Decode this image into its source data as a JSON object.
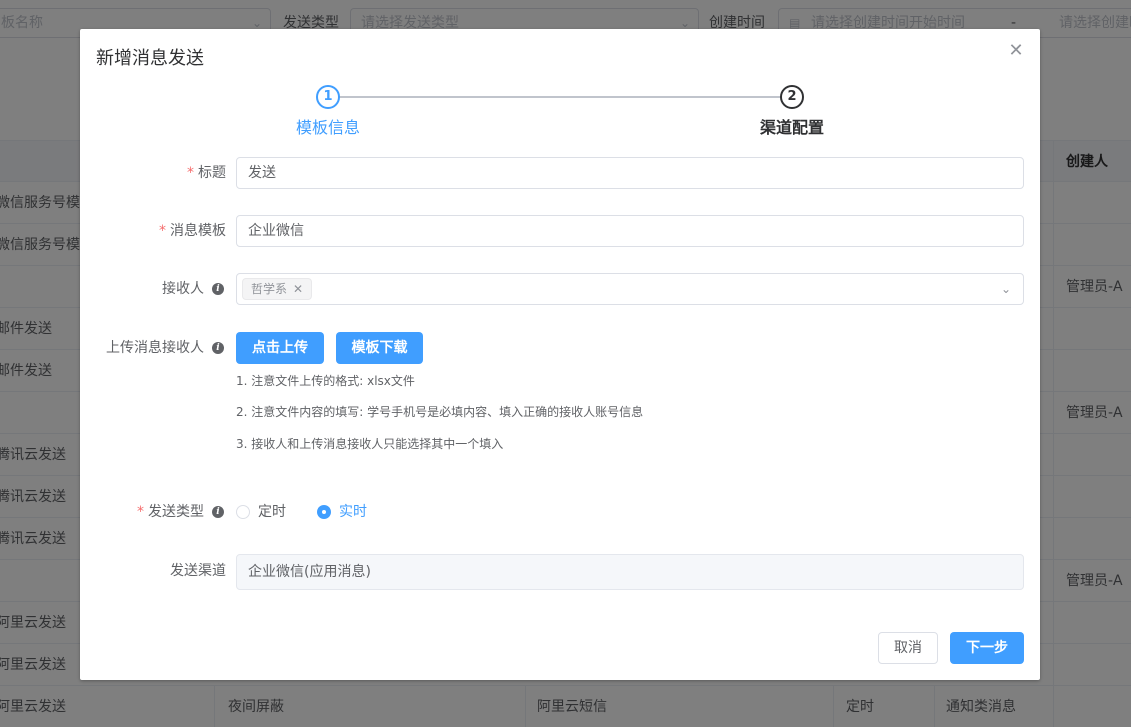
{
  "background": {
    "filters": {
      "template_name_placeholder": "板名称",
      "send_type_label": "发送类型",
      "send_type_placeholder": "请选择发送类型",
      "create_time_label": "创建时间",
      "create_time_start_placeholder": "请选择创建时间开始时间",
      "range_separator": "-",
      "create_time_end_placeholder": "请选择创建时"
    },
    "table": {
      "creator_header": "创建人",
      "rows": [
        {
          "name": "微信服务号模板",
          "creator": ""
        },
        {
          "name": "微信服务号模板",
          "creator": ""
        },
        {
          "name": "",
          "creator": "管理员-A"
        },
        {
          "name": "邮件发送",
          "creator": ""
        },
        {
          "name": "邮件发送",
          "creator": ""
        },
        {
          "name": "",
          "creator": "管理员-A"
        },
        {
          "name": "腾讯云发送",
          "creator": ""
        },
        {
          "name": "腾讯云发送",
          "creator": ""
        },
        {
          "name": "腾讯云发送",
          "creator": ""
        },
        {
          "name": "",
          "creator": "管理员-A"
        },
        {
          "name": "阿里云发送",
          "creator": ""
        },
        {
          "name": "阿里云发送",
          "creator": ""
        }
      ],
      "last_row": {
        "name": "阿里云发送",
        "shield": "夜间屏蔽",
        "channel": "阿里云短信",
        "send_type": "定时",
        "msg_type": "通知类消息"
      }
    }
  },
  "dialog": {
    "title": "新增消息发送",
    "steps": [
      {
        "number": "1",
        "title": "模板信息",
        "status": "active"
      },
      {
        "number": "2",
        "title": "渠道配置",
        "status": "todo"
      }
    ],
    "form": {
      "title_label": "标题",
      "title_value": "发送",
      "template_label": "消息模板",
      "template_value": "企业微信",
      "receiver_label": "接收人",
      "receiver_tag": "哲学系",
      "upload_label": "上传消息接收人",
      "upload_button": "点击上传",
      "download_button": "模板下载",
      "notes": [
        "1. 注意文件上传的格式: xlsx文件",
        "2. 注意文件内容的填写: 学号手机号是必填内容、填入正确的接收人账号信息",
        "3. 接收人和上传消息接收人只能选择其中一个填入"
      ],
      "send_type_label": "发送类型",
      "send_type_options": [
        "定时",
        "实时"
      ],
      "send_type_selected": "实时",
      "channel_label": "发送渠道",
      "channel_value": "企业微信(应用消息)"
    },
    "footer": {
      "cancel": "取消",
      "next": "下一步"
    }
  },
  "colors": {
    "primary": "#409eff",
    "required": "#f56c6c",
    "mask": "rgba(0,0,0,0.5)"
  }
}
